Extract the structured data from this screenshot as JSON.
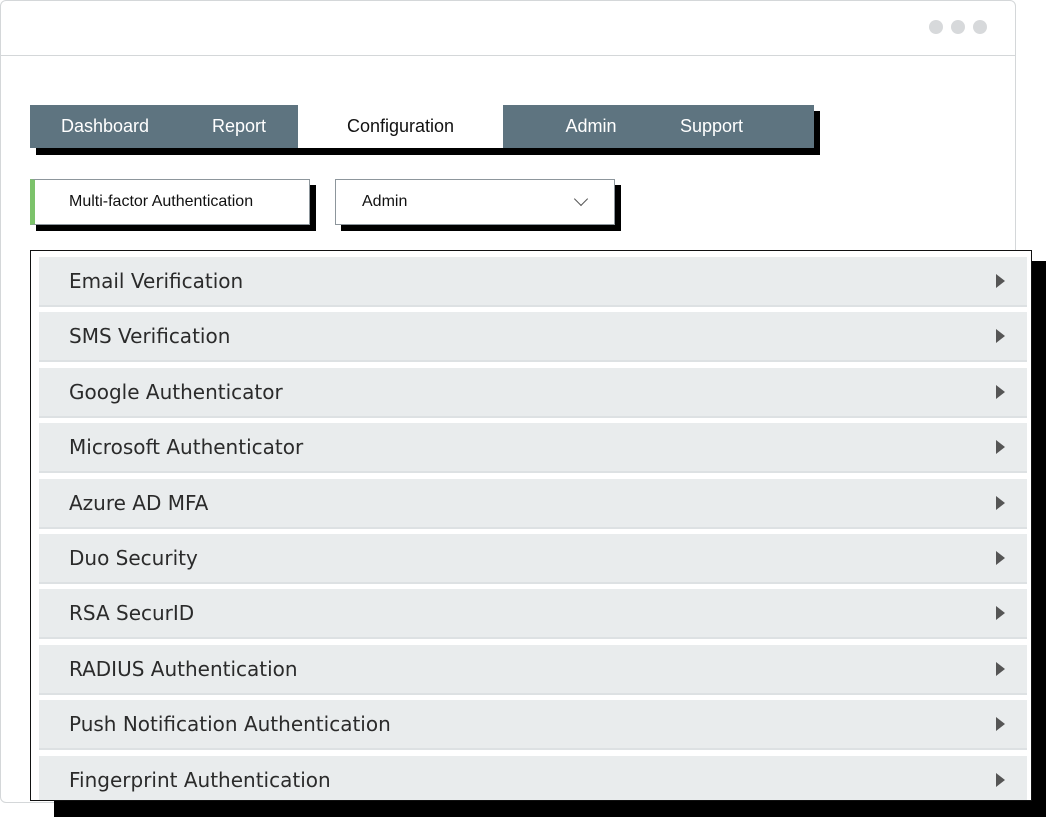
{
  "nav": {
    "tabs": [
      {
        "label": "Dashboard"
      },
      {
        "label": "Report"
      },
      {
        "label": "Configuration",
        "active": true
      },
      {
        "label": "Admin"
      },
      {
        "label": "Support"
      }
    ]
  },
  "controls": {
    "mfa_button_label": "Multi-factor Authentication",
    "role_select_value": "Admin"
  },
  "methods": [
    {
      "label": "Email Verification"
    },
    {
      "label": "SMS Verification"
    },
    {
      "label": "Google Authenticator"
    },
    {
      "label": "Microsoft Authenticator"
    },
    {
      "label": "Azure AD MFA"
    },
    {
      "label": "Duo Security"
    },
    {
      "label": "RSA SecurID"
    },
    {
      "label": "RADIUS Authentication"
    },
    {
      "label": "Push Notification Authentication"
    },
    {
      "label": "Fingerprint Authentication"
    }
  ],
  "colors": {
    "nav_bg": "#5e7480",
    "accent": "#7cc36b",
    "row_bg": "#e9eced"
  },
  "icons": {
    "window_menu": "more-dots-icon",
    "select_chevron": "chevron-down-icon",
    "row_expand": "caret-right-icon"
  }
}
